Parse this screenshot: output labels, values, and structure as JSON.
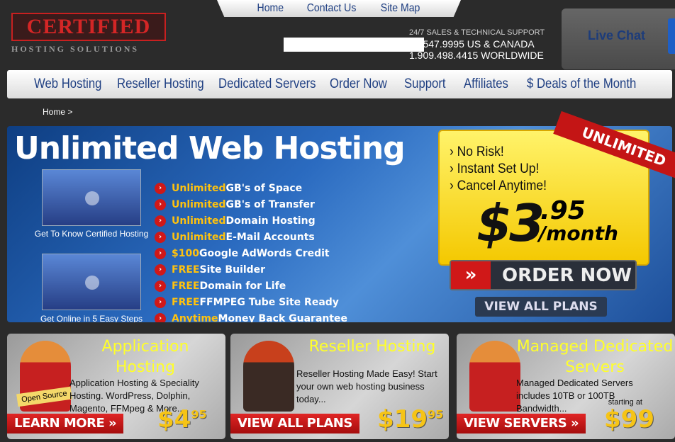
{
  "top_links": [
    "Home",
    "Contact Us",
    "Site Map"
  ],
  "logo": {
    "title": "CERTIFIED",
    "subtitle": "HOSTING SOLUTIONS"
  },
  "support": {
    "label": "24/7 SALES & TECHNICAL SUPPORT",
    "phone_us": "00.547.9995 US & CANADA",
    "phone_world": "1.909.498.4415 WORLDWIDE"
  },
  "live_chat": "Live Chat",
  "nav": [
    "Web Hosting",
    "Reseller Hosting",
    "Dedicated Servers",
    "Order Now",
    "Support",
    "Affiliates",
    "$ Deals of the Month"
  ],
  "breadcrumb": "Home >",
  "hero": {
    "title": "Unlimited Web Hosting",
    "videos": [
      "Get To Know Certified Hosting",
      "Get Online in 5 Easy Steps"
    ],
    "features": [
      {
        "hl": "Unlimited",
        "text": " GB's of Space"
      },
      {
        "hl": "Unlimited",
        "text": " GB's of Transfer"
      },
      {
        "hl": "Unlimited",
        "text": " Domain Hosting"
      },
      {
        "hl": "Unlimited",
        "text": " E-Mail Accounts"
      },
      {
        "hl": "$100",
        "text": " Google AdWords Credit"
      },
      {
        "hl": "FREE",
        "text": " Site Builder"
      },
      {
        "hl": "FREE",
        "text": " Domain for Life"
      },
      {
        "hl": "FREE",
        "text": " FFMPEG Tube Site Ready"
      },
      {
        "hl": "Anytime",
        "text": " Money Back Guarantee"
      }
    ],
    "promo": {
      "ribbon": "UNLIMITED",
      "bullets": [
        "No Risk!",
        "Instant Set Up!",
        "Cancel Anytime!"
      ],
      "price": "$3",
      "cents": ".95",
      "per": "/month"
    },
    "order_now": "ORDER NOW",
    "view_all_plans": "VIEW ALL PLANS"
  },
  "cards": [
    {
      "title": "Application Hosting",
      "desc": "Application Hosting & Speciality Hosting. WordPress, Dolphin, Magento, FFMpeg & More....",
      "button": "LEARN MORE »",
      "price": "$4",
      "cents": "95",
      "badge": "Open Source"
    },
    {
      "title": "Reseller Hosting",
      "desc": "Reseller Hosting Made Easy! Start your own web hosting business today...",
      "button": "VIEW ALL PLANS",
      "price": "$19",
      "cents": "95"
    },
    {
      "title": "Managed Dedicated Servers",
      "desc": "Managed Dedicated Servers includes 10TB or 100TB Bandwidth...",
      "button": "VIEW SERVERS »",
      "price": "$99",
      "starting": "starting at"
    }
  ]
}
